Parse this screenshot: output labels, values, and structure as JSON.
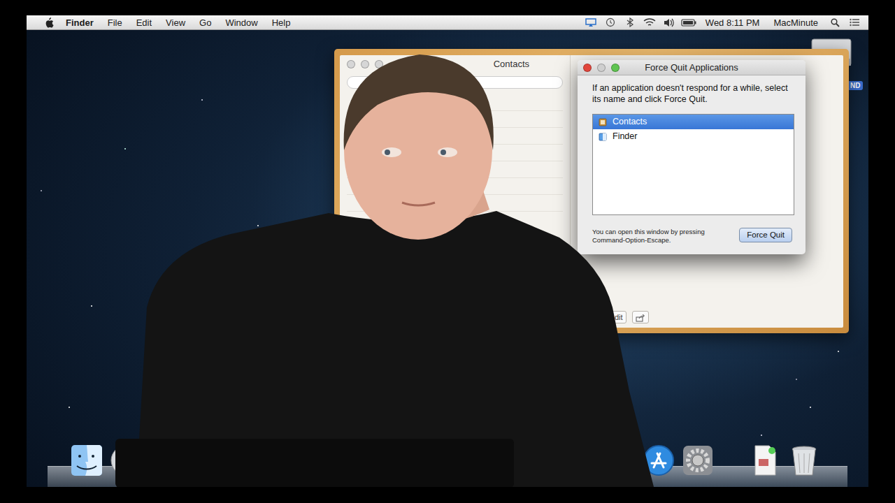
{
  "menubar": {
    "app": "Finder",
    "menus": [
      "File",
      "Edit",
      "View",
      "Go",
      "Window",
      "Help"
    ],
    "clock": "Wed 8:11 PM",
    "user": "MacMinute"
  },
  "desktop_icons": [
    {
      "label": "ND"
    }
  ],
  "contacts_window": {
    "title": "Contacts",
    "edit_button": "dit"
  },
  "force_quit": {
    "title": "Force Quit Applications",
    "message": "If an application doesn't respond for a while, select its name and click Force Quit.",
    "apps": [
      {
        "name": "Contacts",
        "selected": true
      },
      {
        "name": "Finder",
        "selected": false
      }
    ],
    "hint": "You can open this window by pressing Command-Option-Escape.",
    "button": "Force Quit"
  }
}
